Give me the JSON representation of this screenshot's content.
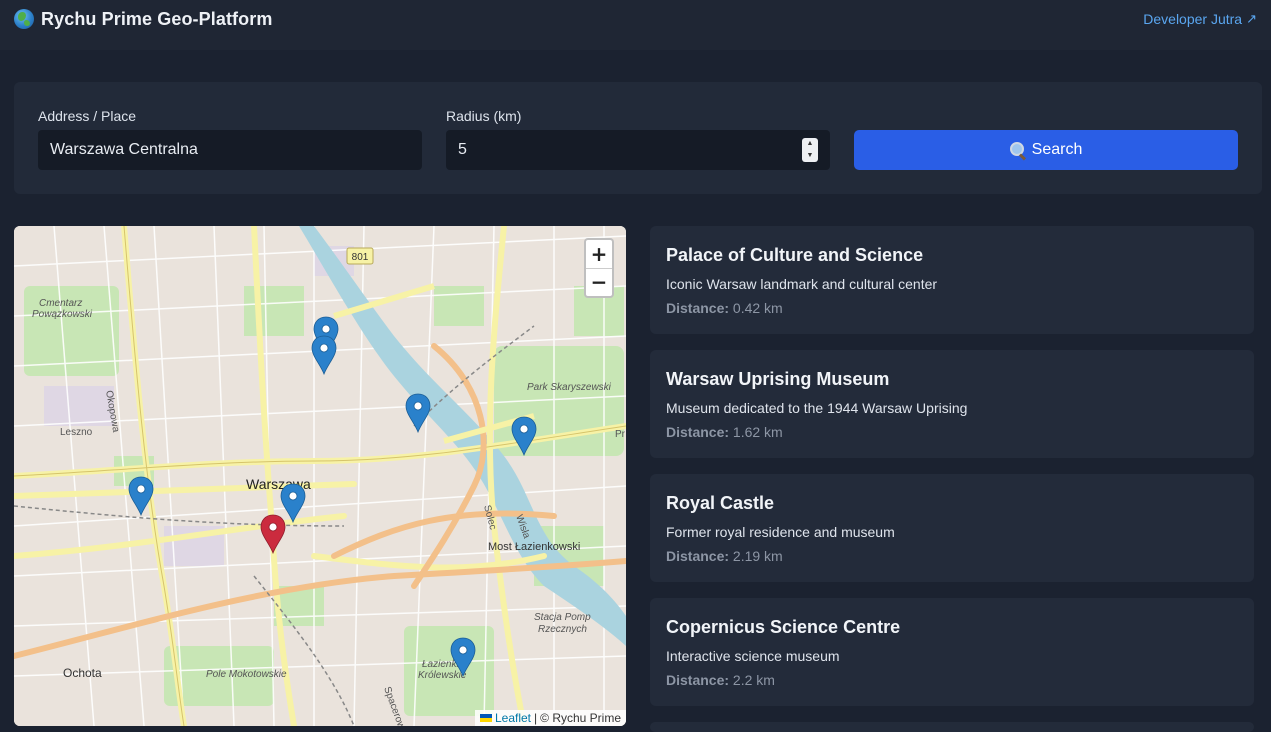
{
  "header": {
    "title": "Rychu Prime Geo-Platform",
    "dev_link": "Developer Jutra",
    "dev_link_icon": "↗"
  },
  "search": {
    "address_label": "Address / Place",
    "address_value": "Warszawa Centralna",
    "radius_label": "Radius (km)",
    "radius_value": "5",
    "button_label": "Search"
  },
  "map": {
    "zoom_in": "+",
    "zoom_out": "−",
    "attribution_link": "Leaflet",
    "attribution_sep": "|",
    "attribution_text": "© Rychu Prime",
    "labels": {
      "road_shield": "801",
      "cemetery_1": "Cmentarz",
      "cemetery_2": "Powązkowski",
      "park_skaryszewski": "Park Skaryszewski",
      "city": "Warszawa",
      "bridge": "Most Łazienkowski",
      "ochota": "Ochota",
      "pole": "Pole Mokotowskie",
      "lazienki_1": "Łazienki",
      "lazienki_2": "Królewskie",
      "stacja_1": "Stacja Pomp",
      "stacja_2": "Rzecznych",
      "okopowa": "Okopowa",
      "leszno": "Leszno",
      "wisla": "Wisła",
      "solec": "Solec",
      "pr": "Pr",
      "spacerowa": "Spacerowa"
    },
    "colors": {
      "marker_result": "#2a81cb",
      "marker_origin": "#cb2b3e",
      "water": "#aad3df",
      "park": "#c8e6b5"
    }
  },
  "results": [
    {
      "name": "Palace of Culture and Science",
      "description": "Iconic Warsaw landmark and cultural center",
      "distance_label": "Distance:",
      "distance_value": "0.42 km"
    },
    {
      "name": "Warsaw Uprising Museum",
      "description": "Museum dedicated to the 1944 Warsaw Uprising",
      "distance_label": "Distance:",
      "distance_value": "1.62 km"
    },
    {
      "name": "Royal Castle",
      "description": "Former royal residence and museum",
      "distance_label": "Distance:",
      "distance_value": "2.19 km"
    },
    {
      "name": "Copernicus Science Centre",
      "description": "Interactive science museum",
      "distance_label": "Distance:",
      "distance_value": "2.2 km"
    }
  ]
}
